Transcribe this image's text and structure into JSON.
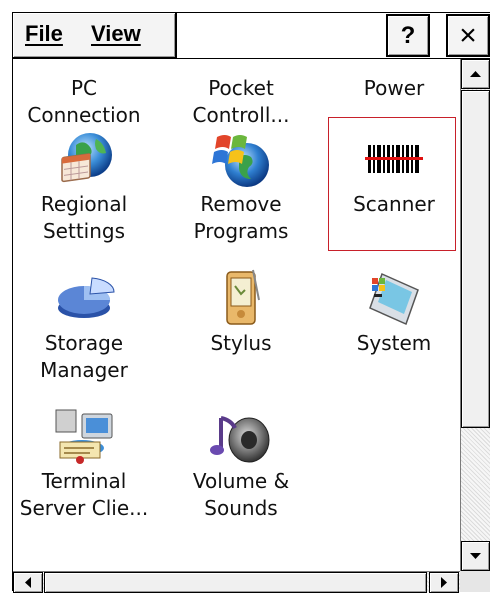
{
  "menu": {
    "file_label": "File",
    "view_label": "View"
  },
  "titlebar_buttons": {
    "help_label": "?",
    "close_label": "×"
  },
  "items": [
    {
      "label": "PC\nConnection",
      "icon": "pc-connection-icon"
    },
    {
      "label": "Pocket\nControll...",
      "icon": "pocket-controller-icon"
    },
    {
      "label": "Power",
      "icon": "power-icon"
    },
    {
      "label": "Regional\nSettings",
      "icon": "globe-calendar-icon"
    },
    {
      "label": "Remove\nPrograms",
      "icon": "windows-globe-icon"
    },
    {
      "label": "Scanner",
      "icon": "barcode-icon"
    },
    {
      "label": "Storage\nManager",
      "icon": "storage-pie-icon"
    },
    {
      "label": "Stylus",
      "icon": "pda-stylus-icon"
    },
    {
      "label": "System",
      "icon": "system-pda-icon"
    },
    {
      "label": "Terminal\nServer Clie...",
      "icon": "terminal-server-icon"
    },
    {
      "label": "Volume &\nSounds",
      "icon": "volume-speaker-icon"
    }
  ],
  "colors": {
    "highlight_border": "#c8202a",
    "barcode_line": "#e01010"
  }
}
